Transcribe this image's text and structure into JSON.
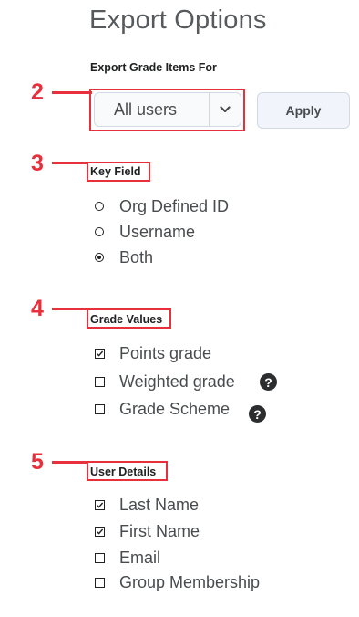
{
  "page": {
    "title": "Export Options"
  },
  "export_for": {
    "label": "Export Grade Items For",
    "selected": "All users",
    "apply_label": "Apply"
  },
  "callouts": {
    "c2": "2",
    "c3": "3",
    "c4": "4",
    "c5": "5"
  },
  "key_field": {
    "label": "Key Field",
    "options": [
      {
        "label": "Org Defined ID",
        "selected": false
      },
      {
        "label": "Username",
        "selected": false
      },
      {
        "label": "Both",
        "selected": true
      }
    ]
  },
  "grade_values": {
    "label": "Grade Values",
    "options": [
      {
        "label": "Points grade",
        "checked": true,
        "help": false
      },
      {
        "label": "Weighted grade",
        "checked": false,
        "help": true
      },
      {
        "label": "Grade Scheme",
        "checked": false,
        "help": true
      }
    ]
  },
  "user_details": {
    "label": "User Details",
    "options": [
      {
        "label": "Last Name",
        "checked": true
      },
      {
        "label": "First Name",
        "checked": true
      },
      {
        "label": "Email",
        "checked": false
      },
      {
        "label": "Group Membership",
        "checked": false
      }
    ]
  },
  "icons": {
    "dropdown": "chevron-down-icon",
    "help": "help-circle-icon"
  },
  "colors": {
    "callout": "#e8303c",
    "text": "#494c4e"
  }
}
